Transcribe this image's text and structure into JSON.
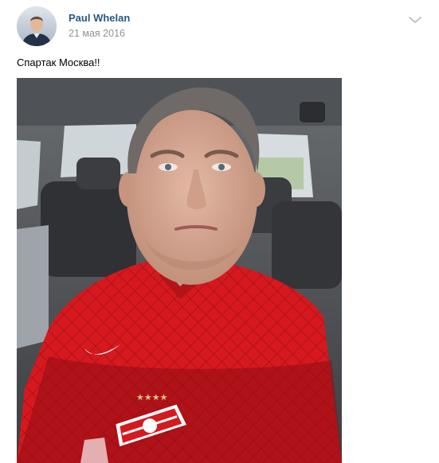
{
  "post": {
    "author": "Paul Whelan",
    "date": "21 мая 2016",
    "text": "Спартак Москва!!"
  },
  "icons": {
    "menu": "chevron-down-icon"
  },
  "colors": {
    "author_link": "#2a5885",
    "date_text": "#939393",
    "jersey_red": "#d6191f"
  }
}
